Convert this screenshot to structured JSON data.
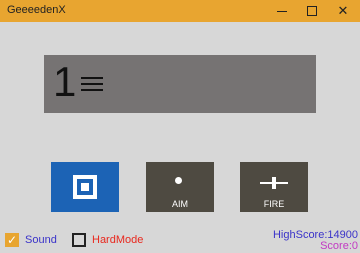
{
  "window": {
    "title": "GeeeedenX",
    "buttons": {
      "minimize": "minimize-icon",
      "maximize": "maximize-icon",
      "close": "close-icon"
    }
  },
  "display": {
    "number": "1",
    "menu_icon": "menu-icon"
  },
  "controls": {
    "blue_icon": "stop-square-icon",
    "aim": {
      "label": "AIM",
      "icon": "dot-icon"
    },
    "fire": {
      "label": "FIRE",
      "icon": "crosshair-icon"
    }
  },
  "toggles": {
    "sound": {
      "label": "Sound",
      "checked": true
    },
    "hard_mode": {
      "label": "HardMode",
      "checked": false
    }
  },
  "stats": {
    "highscore": "HighScore:14900",
    "score": "Score:0"
  },
  "colors": {
    "titlebar": "#e8a530",
    "background": "#d7d7d7",
    "display": "#767373",
    "blue_button": "#1c63b5",
    "dark_button": "#4e4a41",
    "sound_label": "#3a33c9",
    "hardmode_label": "#e8281e",
    "highscore": "#3a33c9",
    "score": "#c23ac3"
  }
}
